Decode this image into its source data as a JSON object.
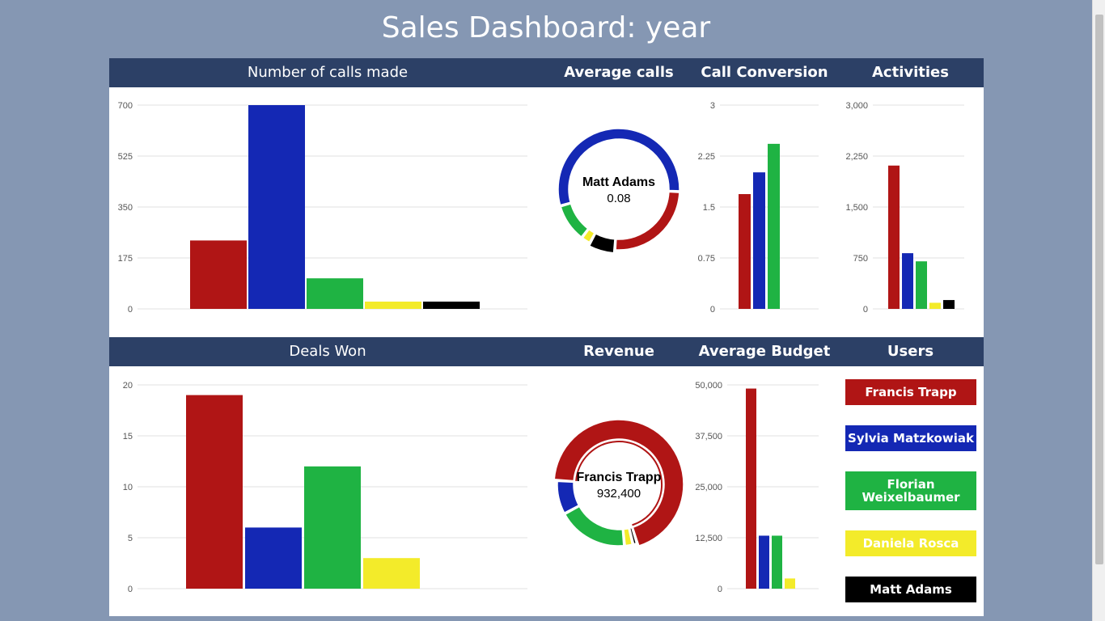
{
  "page": {
    "title": "Sales Dashboard: year"
  },
  "colors": {
    "red": "#b01515",
    "blue": "#1428b4",
    "green": "#1fb343",
    "yellow": "#f3eb2a",
    "black": "#000000",
    "header": "#2c4066"
  },
  "users": [
    {
      "name": "Francis Trapp",
      "color": "#b01515"
    },
    {
      "name": "Sylvia Matzkowiak",
      "color": "#1428b4"
    },
    {
      "name": "Florian Weixelbaumer",
      "color": "#1fb343"
    },
    {
      "name": "Daniela Rosca",
      "color": "#f3eb2a"
    },
    {
      "name": "Matt Adams",
      "color": "#000000"
    }
  ],
  "row1": {
    "calls_header": "Number of calls made",
    "avg_header": "Average calls",
    "conv_header": "Call Conversion",
    "act_header": "Activities"
  },
  "row2": {
    "deals_header": "Deals Won",
    "rev_header": "Revenue",
    "budget_header": "Average Budget",
    "users_header": "Users"
  },
  "chart_data": [
    {
      "id": "calls",
      "type": "bar",
      "title": "Number of calls made",
      "categories": [
        "Francis Trapp",
        "Sylvia Matzkowiak",
        "Florian Weixelbaumer",
        "Daniela Rosca",
        "Matt Adams"
      ],
      "values": [
        235,
        700,
        105,
        25,
        25
      ],
      "ylim": [
        0,
        700
      ],
      "yticks": [
        "0",
        "175",
        "350",
        "525",
        "700"
      ]
    },
    {
      "id": "avg_calls",
      "type": "pie",
      "title": "Average calls",
      "categories": [
        "Francis Trapp",
        "Sylvia Matzkowiak",
        "Florian Weixelbaumer",
        "Daniela Rosca",
        "Matt Adams"
      ],
      "values": [
        0.3,
        0.65,
        0.12,
        0.03,
        0.08
      ],
      "center_label": "Matt Adams",
      "center_value": "0.08",
      "highlight": 4
    },
    {
      "id": "conversion",
      "type": "bar",
      "title": "Call Conversion",
      "categories": [
        "Francis Trapp",
        "Sylvia Matzkowiak",
        "Florian Weixelbaumer"
      ],
      "values": [
        1.69,
        2.01,
        2.43
      ],
      "ylim": [
        0,
        3
      ],
      "yticks": [
        "0",
        "0.75",
        "1.5",
        "2.25",
        "3"
      ]
    },
    {
      "id": "activities",
      "type": "bar",
      "title": "Activities",
      "categories": [
        "Francis Trapp",
        "Sylvia Matzkowiak",
        "Florian Weixelbaumer",
        "Daniela Rosca",
        "Matt Adams"
      ],
      "values": [
        2110,
        820,
        700,
        90,
        130
      ],
      "ylim": [
        0,
        3000
      ],
      "yticks": [
        "0",
        "750",
        "1,500",
        "2,250",
        "3,000"
      ]
    },
    {
      "id": "deals",
      "type": "bar",
      "title": "Deals Won",
      "categories": [
        "Francis Trapp",
        "Sylvia Matzkowiak",
        "Florian Weixelbaumer",
        "Daniela Rosca"
      ],
      "values": [
        19,
        6,
        12,
        3
      ],
      "ylim": [
        0,
        20
      ],
      "yticks": [
        "0",
        "5",
        "10",
        "15",
        "20"
      ]
    },
    {
      "id": "revenue",
      "type": "pie",
      "title": "Revenue",
      "categories": [
        "Francis Trapp",
        "Sylvia Matzkowiak",
        "Florian Weixelbaumer",
        "Daniela Rosca",
        "Matt Adams"
      ],
      "values": [
        932400,
        120000,
        250000,
        30000,
        15000
      ],
      "center_label": "Francis Trapp",
      "center_value": "932,400",
      "highlight": 0
    },
    {
      "id": "budget",
      "type": "bar",
      "title": "Average Budget",
      "categories": [
        "Francis Trapp",
        "Sylvia Matzkowiak",
        "Florian Weixelbaumer",
        "Daniela Rosca"
      ],
      "values": [
        49100,
        13000,
        13000,
        2500
      ],
      "ylim": [
        0,
        50000
      ],
      "yticks": [
        "0",
        "12,500",
        "25,000",
        "37,500",
        "50,000"
      ]
    }
  ]
}
